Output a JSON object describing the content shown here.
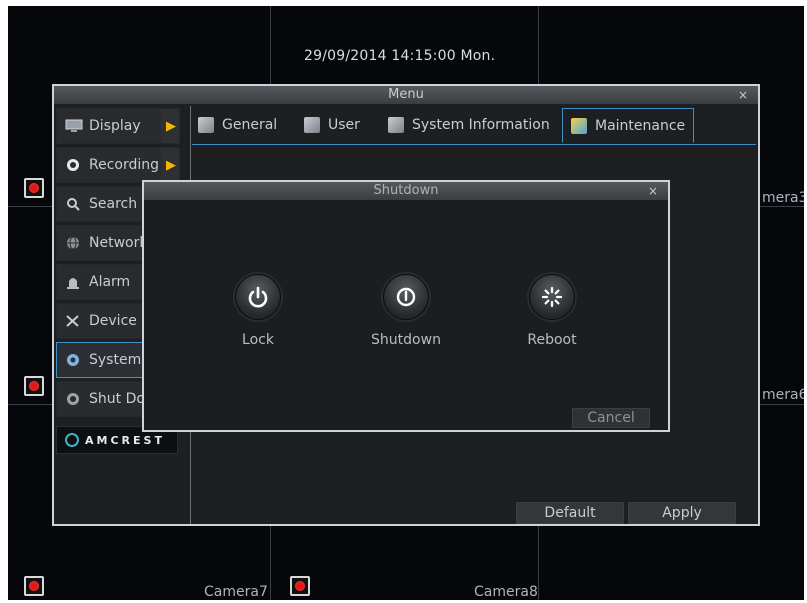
{
  "osd": {
    "datetime": "29/09/2014  14:15:00 Mon.",
    "camera_labels": {
      "camera3": "mera3",
      "camera6": "mera6",
      "camera7": "Camera7",
      "camera8": "Camera8"
    }
  },
  "menu": {
    "title": "Menu",
    "close_icon": "×",
    "sidebar": [
      {
        "label": "Display",
        "icon": "monitor-icon"
      },
      {
        "label": "Recording",
        "icon": "record-icon"
      },
      {
        "label": "Search",
        "icon": "search-icon"
      },
      {
        "label": "Network",
        "icon": "network-icon"
      },
      {
        "label": "Alarm",
        "icon": "alarm-icon"
      },
      {
        "label": "Device",
        "icon": "tools-icon"
      },
      {
        "label": "System",
        "icon": "gear-icon"
      },
      {
        "label": "Shut Down",
        "icon": "power-icon"
      }
    ],
    "logo_text": "AMCREST",
    "tabs": [
      {
        "label": "General"
      },
      {
        "label": "User"
      },
      {
        "label": "System Information"
      },
      {
        "label": "Maintenance"
      }
    ],
    "buttons": {
      "default": "Default",
      "apply": "Apply"
    }
  },
  "dialog": {
    "title": "Shutdown",
    "close_icon": "×",
    "actions": [
      {
        "label": "Lock",
        "icon": "lock-power-icon"
      },
      {
        "label": "Shutdown",
        "icon": "shutdown-icon"
      },
      {
        "label": "Reboot",
        "icon": "reboot-icon"
      }
    ],
    "cancel": "Cancel"
  },
  "colors": {
    "accent": "#3f8fc8",
    "arrow": "#f5b800",
    "record": "#e01818"
  }
}
